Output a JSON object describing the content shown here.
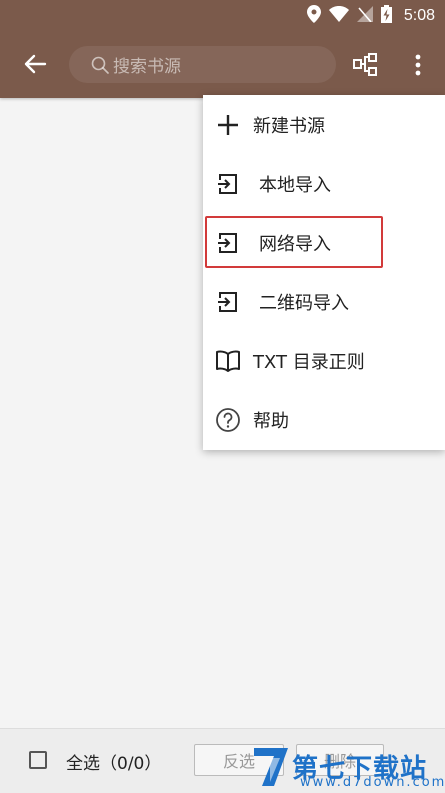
{
  "status_bar": {
    "time": "5:08"
  },
  "app_bar": {
    "search_placeholder": "搜索书源"
  },
  "menu": {
    "items": [
      {
        "label": "新建书源",
        "icon": "plus-icon"
      },
      {
        "label": "本地导入",
        "icon": "import-icon"
      },
      {
        "label": "网络导入",
        "icon": "import-icon",
        "highlighted": true
      },
      {
        "label": "二维码导入",
        "icon": "import-icon"
      },
      {
        "label": "TXT 目录正则",
        "icon": "book-icon"
      },
      {
        "label": "帮助",
        "icon": "help-icon"
      }
    ]
  },
  "bottom_bar": {
    "select_all_label": "全选（0/0）",
    "invert_label": "反选",
    "delete_label": "删除"
  },
  "watermark": {
    "text": "第七下载站",
    "url": "www.d7down.com"
  },
  "colors": {
    "app_bar": "#7b5a4b",
    "highlight": "#d23a3a",
    "watermark": "#1f72c8"
  }
}
